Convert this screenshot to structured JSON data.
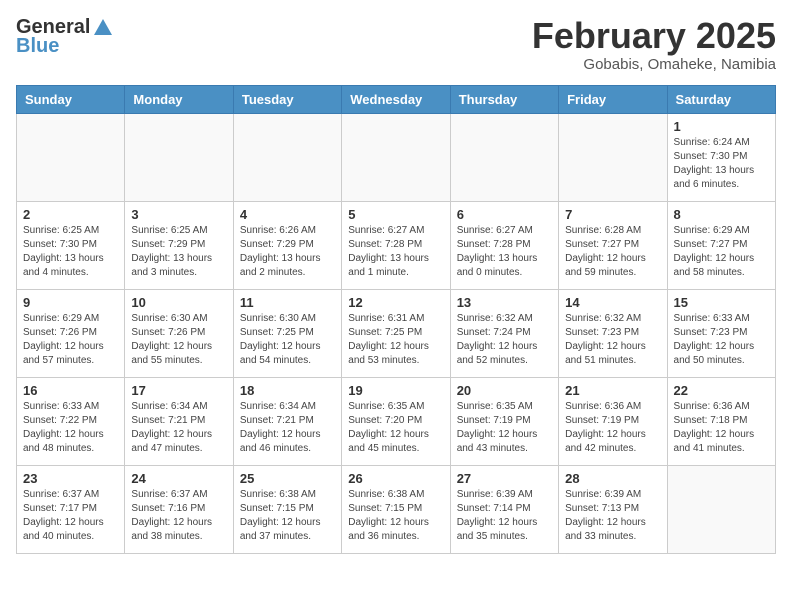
{
  "header": {
    "logo_general": "General",
    "logo_blue": "Blue",
    "month_year": "February 2025",
    "location": "Gobabis, Omaheke, Namibia"
  },
  "weekdays": [
    "Sunday",
    "Monday",
    "Tuesday",
    "Wednesday",
    "Thursday",
    "Friday",
    "Saturday"
  ],
  "weeks": [
    [
      {
        "day": "",
        "info": ""
      },
      {
        "day": "",
        "info": ""
      },
      {
        "day": "",
        "info": ""
      },
      {
        "day": "",
        "info": ""
      },
      {
        "day": "",
        "info": ""
      },
      {
        "day": "",
        "info": ""
      },
      {
        "day": "1",
        "info": "Sunrise: 6:24 AM\nSunset: 7:30 PM\nDaylight: 13 hours\nand 6 minutes."
      }
    ],
    [
      {
        "day": "2",
        "info": "Sunrise: 6:25 AM\nSunset: 7:30 PM\nDaylight: 13 hours\nand 4 minutes."
      },
      {
        "day": "3",
        "info": "Sunrise: 6:25 AM\nSunset: 7:29 PM\nDaylight: 13 hours\nand 3 minutes."
      },
      {
        "day": "4",
        "info": "Sunrise: 6:26 AM\nSunset: 7:29 PM\nDaylight: 13 hours\nand 2 minutes."
      },
      {
        "day": "5",
        "info": "Sunrise: 6:27 AM\nSunset: 7:28 PM\nDaylight: 13 hours\nand 1 minute."
      },
      {
        "day": "6",
        "info": "Sunrise: 6:27 AM\nSunset: 7:28 PM\nDaylight: 13 hours\nand 0 minutes."
      },
      {
        "day": "7",
        "info": "Sunrise: 6:28 AM\nSunset: 7:27 PM\nDaylight: 12 hours\nand 59 minutes."
      },
      {
        "day": "8",
        "info": "Sunrise: 6:29 AM\nSunset: 7:27 PM\nDaylight: 12 hours\nand 58 minutes."
      }
    ],
    [
      {
        "day": "9",
        "info": "Sunrise: 6:29 AM\nSunset: 7:26 PM\nDaylight: 12 hours\nand 57 minutes."
      },
      {
        "day": "10",
        "info": "Sunrise: 6:30 AM\nSunset: 7:26 PM\nDaylight: 12 hours\nand 55 minutes."
      },
      {
        "day": "11",
        "info": "Sunrise: 6:30 AM\nSunset: 7:25 PM\nDaylight: 12 hours\nand 54 minutes."
      },
      {
        "day": "12",
        "info": "Sunrise: 6:31 AM\nSunset: 7:25 PM\nDaylight: 12 hours\nand 53 minutes."
      },
      {
        "day": "13",
        "info": "Sunrise: 6:32 AM\nSunset: 7:24 PM\nDaylight: 12 hours\nand 52 minutes."
      },
      {
        "day": "14",
        "info": "Sunrise: 6:32 AM\nSunset: 7:23 PM\nDaylight: 12 hours\nand 51 minutes."
      },
      {
        "day": "15",
        "info": "Sunrise: 6:33 AM\nSunset: 7:23 PM\nDaylight: 12 hours\nand 50 minutes."
      }
    ],
    [
      {
        "day": "16",
        "info": "Sunrise: 6:33 AM\nSunset: 7:22 PM\nDaylight: 12 hours\nand 48 minutes."
      },
      {
        "day": "17",
        "info": "Sunrise: 6:34 AM\nSunset: 7:21 PM\nDaylight: 12 hours\nand 47 minutes."
      },
      {
        "day": "18",
        "info": "Sunrise: 6:34 AM\nSunset: 7:21 PM\nDaylight: 12 hours\nand 46 minutes."
      },
      {
        "day": "19",
        "info": "Sunrise: 6:35 AM\nSunset: 7:20 PM\nDaylight: 12 hours\nand 45 minutes."
      },
      {
        "day": "20",
        "info": "Sunrise: 6:35 AM\nSunset: 7:19 PM\nDaylight: 12 hours\nand 43 minutes."
      },
      {
        "day": "21",
        "info": "Sunrise: 6:36 AM\nSunset: 7:19 PM\nDaylight: 12 hours\nand 42 minutes."
      },
      {
        "day": "22",
        "info": "Sunrise: 6:36 AM\nSunset: 7:18 PM\nDaylight: 12 hours\nand 41 minutes."
      }
    ],
    [
      {
        "day": "23",
        "info": "Sunrise: 6:37 AM\nSunset: 7:17 PM\nDaylight: 12 hours\nand 40 minutes."
      },
      {
        "day": "24",
        "info": "Sunrise: 6:37 AM\nSunset: 7:16 PM\nDaylight: 12 hours\nand 38 minutes."
      },
      {
        "day": "25",
        "info": "Sunrise: 6:38 AM\nSunset: 7:15 PM\nDaylight: 12 hours\nand 37 minutes."
      },
      {
        "day": "26",
        "info": "Sunrise: 6:38 AM\nSunset: 7:15 PM\nDaylight: 12 hours\nand 36 minutes."
      },
      {
        "day": "27",
        "info": "Sunrise: 6:39 AM\nSunset: 7:14 PM\nDaylight: 12 hours\nand 35 minutes."
      },
      {
        "day": "28",
        "info": "Sunrise: 6:39 AM\nSunset: 7:13 PM\nDaylight: 12 hours\nand 33 minutes."
      },
      {
        "day": "",
        "info": ""
      }
    ]
  ]
}
